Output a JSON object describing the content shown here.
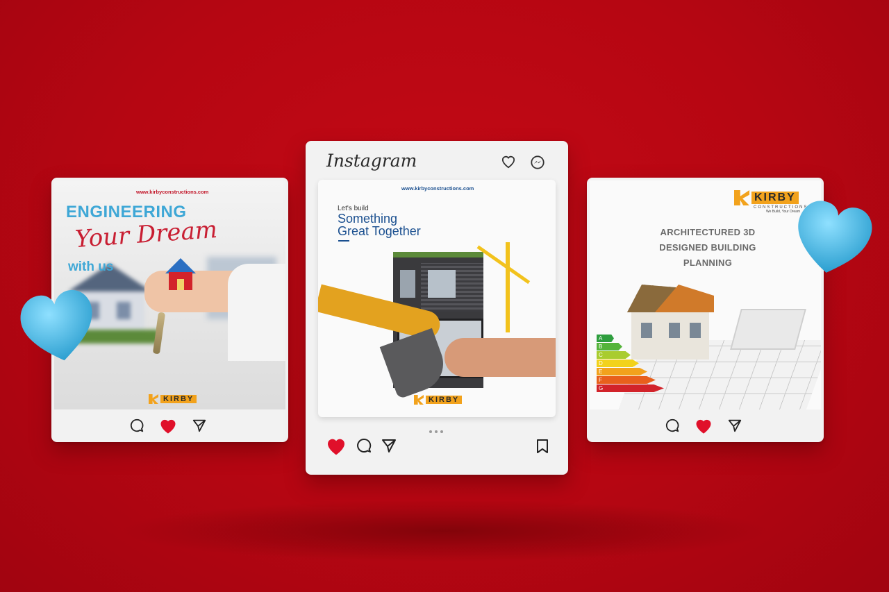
{
  "left_post": {
    "url": "www.kirbyconstructions.com",
    "headline_1": "ENGINEERING",
    "headline_2": "Your Dream",
    "headline_3": "with us",
    "logo_text": "KIRBY"
  },
  "center_post": {
    "app_name": "Instagram",
    "url": "www.kirbyconstructions.com",
    "kicker": "Let's build",
    "headline_1": "Something",
    "headline_2": "Great Together",
    "logo_text": "KIRBY"
  },
  "right_post": {
    "logo_text": "KIRBY",
    "logo_sub": "CONSTRUCTIONS",
    "tagline": "We Build, Your Dream",
    "title_1": "ARCHITECTURED 3D",
    "title_2": "DESIGNED BUILDING",
    "title_3": "PLANNING",
    "energy_labels": [
      "A",
      "B",
      "C",
      "D",
      "E",
      "F",
      "G"
    ]
  },
  "colors": {
    "background": "#b60612",
    "heart_red": "#e0102a",
    "heart_blue": "#3bb4e0",
    "brand_orange": "#f2a21c",
    "headline_blue": "#1a4f8f"
  },
  "icons": {
    "like": "heart-icon",
    "comment": "comment-icon",
    "share": "send-icon",
    "save": "bookmark-icon",
    "messenger": "messenger-icon"
  }
}
